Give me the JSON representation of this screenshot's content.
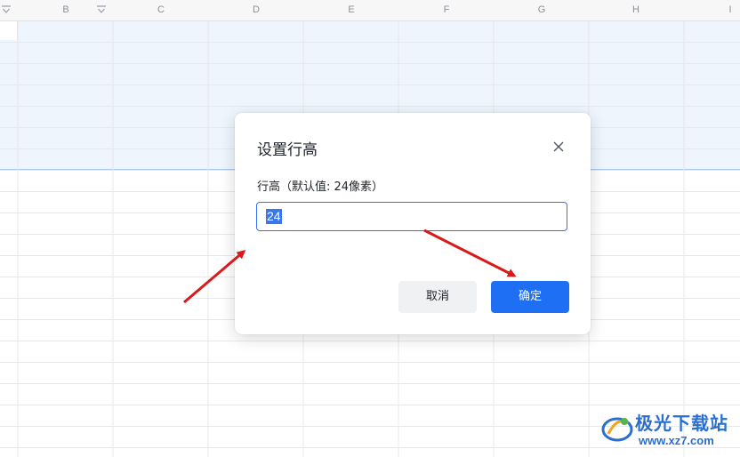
{
  "columns": [
    "B",
    "C",
    "D",
    "E",
    "F",
    "G",
    "H",
    "I"
  ],
  "dialog": {
    "title": "设置行高",
    "field_label": "行高（默认值: 24像素）",
    "input_value": "24",
    "cancel_label": "取消",
    "ok_label": "确定"
  },
  "watermark": {
    "brand": "极光下载站",
    "url": "www.xz7.com"
  },
  "colors": {
    "accent": "#1f6ff5",
    "selection_band": "#eef5fd",
    "arrow": "#d9191c"
  },
  "icons": [
    "filter-icon",
    "close-icon",
    "red-arrow"
  ]
}
